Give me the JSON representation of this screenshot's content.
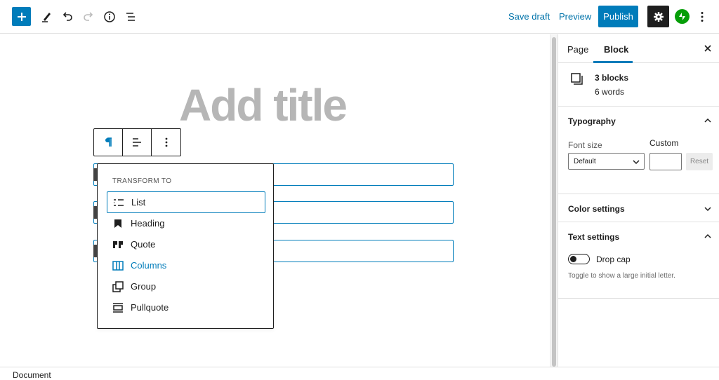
{
  "toolbar": {
    "save_draft": "Save draft",
    "preview": "Preview",
    "publish": "Publish"
  },
  "editor": {
    "title_placeholder": "Add title"
  },
  "transform_menu": {
    "heading": "TRANSFORM TO",
    "items": [
      {
        "label": "List",
        "icon": "list-icon",
        "active": true
      },
      {
        "label": "Heading",
        "icon": "bookmark-icon"
      },
      {
        "label": "Quote",
        "icon": "quote-icon"
      },
      {
        "label": "Columns",
        "icon": "columns-icon",
        "accent": true
      },
      {
        "label": "Group",
        "icon": "group-icon"
      },
      {
        "label": "Pullquote",
        "icon": "pullquote-icon"
      }
    ]
  },
  "sidebar": {
    "tabs": [
      "Page",
      "Block"
    ],
    "active_tab": "Block",
    "blocks_count": "3 blocks",
    "words_count": "6 words",
    "typography": {
      "heading": "Typography",
      "font_size_label": "Font size",
      "custom_label": "Custom",
      "select_value": "Default",
      "reset_label": "Reset"
    },
    "color_settings": "Color settings",
    "text_settings": {
      "heading": "Text settings",
      "drop_cap_label": "Drop cap",
      "help": "Toggle to show a large initial letter."
    }
  },
  "footer": {
    "breadcrumb": "Document"
  },
  "colors": {
    "accent": "#007cba",
    "dark": "#1e1e1e",
    "jetpack": "#069e08"
  }
}
